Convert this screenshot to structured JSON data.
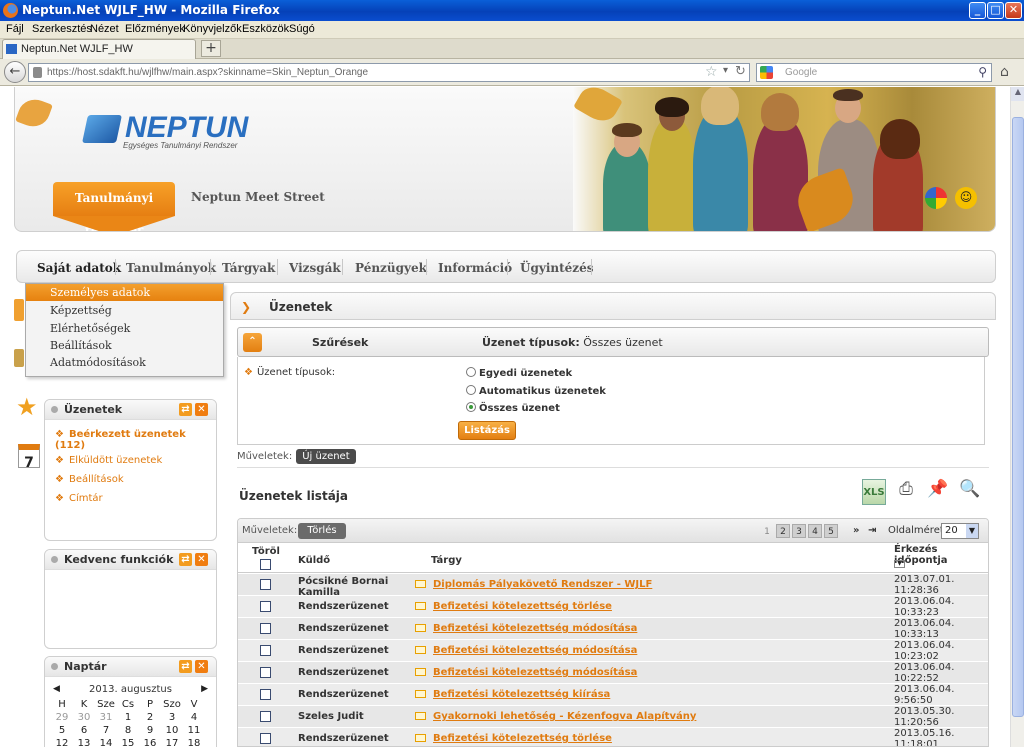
{
  "window": {
    "title": "Neptun.Net WJLF_HW - Mozilla Firefox",
    "min": "_",
    "max": "□",
    "close": "✕"
  },
  "menubar": [
    "Fájl",
    "Szerkesztés",
    "Nézet",
    "Előzmények",
    "Könyvjelzők",
    "Eszközök",
    "Súgó"
  ],
  "tab": {
    "label": "Neptun.Net WJLF_HW",
    "newtab": "+"
  },
  "nav": {
    "back": "←",
    "url": "https://host.sdakft.hu/wjlfhw/main.aspx?skinname=Skin_Neptun_Orange",
    "search_placeholder": "Google",
    "home": "⌂"
  },
  "header": {
    "logo_word": "NEPTUN",
    "logo_sub": "Egységes Tanulmányi Rendszer",
    "main_button": "Tanulmányi rendszer",
    "meet": "Neptun Meet Street"
  },
  "mainmenu": [
    "Saját adatok",
    "Tanulmányok",
    "Tárgyak",
    "Vizsgák",
    "Pénzügyek",
    "Információ",
    "Ügyintézés"
  ],
  "submenu": [
    "Személyes adatok",
    "Képzettség",
    "Elérhetőségek",
    "Beállítások",
    "Adatmódosítások"
  ],
  "messages_box": {
    "title": "Üzenetek",
    "links": [
      "Beérkezett üzenetek (112)",
      "Elküldött üzenetek",
      "Beállítások",
      "Címtár"
    ]
  },
  "favorites_box": {
    "title": "Kedvenc funkciók"
  },
  "calendar_box": {
    "title": "Naptár",
    "month": "2013. augusztus",
    "days": [
      "H",
      "K",
      "Sze",
      "Cs",
      "P",
      "Szo",
      "V"
    ],
    "weeks": [
      [
        "29",
        "30",
        "31",
        "1",
        "2",
        "3",
        "4"
      ],
      [
        "5",
        "6",
        "7",
        "8",
        "9",
        "10",
        "11"
      ],
      [
        "12",
        "13",
        "14",
        "15",
        "16",
        "17",
        "18"
      ]
    ]
  },
  "section": {
    "title": "Üzenetek"
  },
  "filter": {
    "title": "Szűrések",
    "type_label": "Üzenet típusok:",
    "type_value": "Összes üzenet",
    "field_label": "Üzenet típusok:",
    "options": [
      "Egyedi üzenetek",
      "Automatikus üzenetek",
      "Összes üzenet"
    ],
    "selected_index": 2,
    "list_button": "Listázás"
  },
  "actions": {
    "label": "Műveletek:",
    "new_message": "Új üzenet"
  },
  "list": {
    "title": "Üzenetek listája",
    "ops_label": "Műveletek:",
    "delete_button": "Törlés",
    "pages": [
      "1",
      "2",
      "3",
      "4",
      "5"
    ],
    "page_size_label": "Oldalméret",
    "page_size": "20",
    "columns": {
      "delete": "Töröl",
      "sender": "Küldő",
      "subject": "Tárgy",
      "date": "Érkezés időpontja"
    },
    "rows": [
      {
        "sender1": "Pócsikné Bornai",
        "sender2": "Kamilla",
        "subject": "Diplomás Pályakövető Rendszer - WJLF",
        "date1": "2013.07.01.",
        "date2": "11:28:36"
      },
      {
        "sender1": "Rendszerüzenet",
        "sender2": "",
        "subject": "Befizetési kötelezettség törlése",
        "date1": "2013.06.04.",
        "date2": "10:33:23"
      },
      {
        "sender1": "Rendszerüzenet",
        "sender2": "",
        "subject": "Befizetési kötelezettség módosítása",
        "date1": "2013.06.04.",
        "date2": "10:33:13"
      },
      {
        "sender1": "Rendszerüzenet",
        "sender2": "",
        "subject": "Befizetési kötelezettség módosítása",
        "date1": "2013.06.04.",
        "date2": "10:23:02"
      },
      {
        "sender1": "Rendszerüzenet",
        "sender2": "",
        "subject": "Befizetési kötelezettség módosítása",
        "date1": "2013.06.04.",
        "date2": "10:22:52"
      },
      {
        "sender1": "Rendszerüzenet",
        "sender2": "",
        "subject": "Befizetési kötelezettség kiírása",
        "date1": "2013.06.04.",
        "date2": "9:56:50"
      },
      {
        "sender1": "Szeles Judit",
        "sender2": "",
        "subject": "Gyakornoki lehetőség - Kézenfogva Alapítvány",
        "date1": "2013.05.30.",
        "date2": "11:20:56"
      },
      {
        "sender1": "Rendszerüzenet",
        "sender2": "",
        "subject": "Befizetési kötelezettség törlése",
        "date1": "2013.05.16.",
        "date2": "11:18:01"
      }
    ]
  }
}
